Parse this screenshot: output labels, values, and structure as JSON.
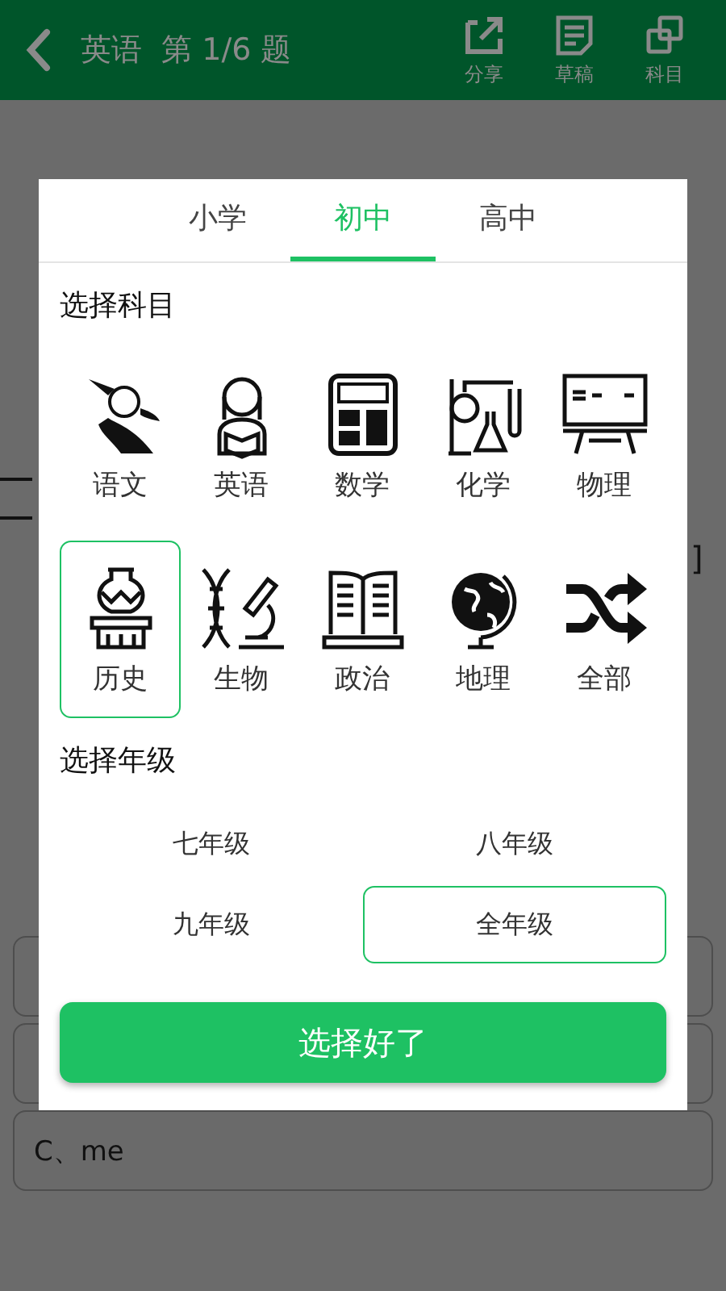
{
  "header": {
    "title": "英语  第 1/6 题",
    "actions": [
      {
        "kind": "share",
        "label": "分享"
      },
      {
        "kind": "draft",
        "label": "草稿"
      },
      {
        "kind": "subject",
        "label": "科目"
      }
    ]
  },
  "background": {
    "bracket": "]",
    "options": [
      {
        "kind": "covered"
      },
      {
        "kind": "covered"
      },
      {
        "kind": "text",
        "text": "C、me"
      }
    ]
  },
  "dialog": {
    "tabs": [
      {
        "label": "小学",
        "selected": false
      },
      {
        "label": "初中",
        "selected": true
      },
      {
        "label": "高中",
        "selected": false
      }
    ],
    "subject_heading": "选择科目",
    "subjects": [
      {
        "kind": "scholar",
        "label": "语文",
        "selected": false
      },
      {
        "kind": "reader",
        "label": "英语",
        "selected": false
      },
      {
        "kind": "calculator",
        "label": "数学",
        "selected": false
      },
      {
        "kind": "lab",
        "label": "化学",
        "selected": false
      },
      {
        "kind": "board",
        "label": "物理",
        "selected": false
      },
      {
        "kind": "vase",
        "label": "历史",
        "selected": true
      },
      {
        "kind": "microscope",
        "label": "生物",
        "selected": false
      },
      {
        "kind": "book",
        "label": "政治",
        "selected": false
      },
      {
        "kind": "globe",
        "label": "地理",
        "selected": false
      },
      {
        "kind": "shuffle",
        "label": "全部",
        "selected": false
      }
    ],
    "grade_heading": "选择年级",
    "grades": [
      {
        "label": "七年级",
        "selected": false
      },
      {
        "label": "八年级",
        "selected": false
      },
      {
        "label": "九年级",
        "selected": false
      },
      {
        "label": "全年级",
        "selected": true
      }
    ],
    "confirm": "选择好了"
  }
}
